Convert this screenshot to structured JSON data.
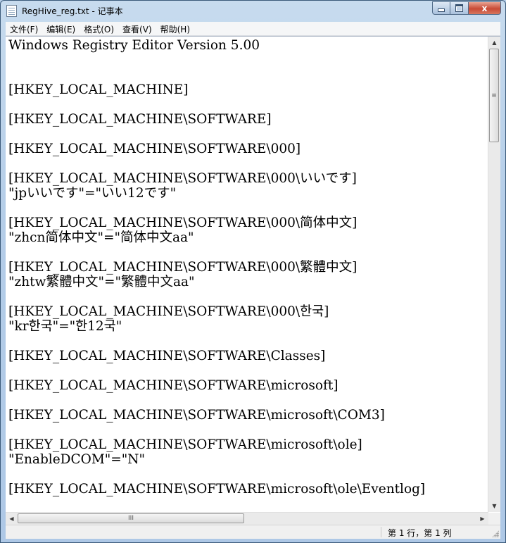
{
  "window": {
    "title": "RegHive_reg.txt - 记事本",
    "minimize_glyph": "",
    "close_glyph": "x"
  },
  "menubar": {
    "items": [
      "文件(F)",
      "编辑(E)",
      "格式(O)",
      "查看(V)",
      "帮助(H)"
    ]
  },
  "editor": {
    "lines": [
      "Windows Registry Editor Version 5.00",
      "",
      "",
      "[HKEY_LOCAL_MACHINE]",
      "",
      "[HKEY_LOCAL_MACHINE\\SOFTWARE]",
      "",
      "[HKEY_LOCAL_MACHINE\\SOFTWARE\\000]",
      "",
      "[HKEY_LOCAL_MACHINE\\SOFTWARE\\000\\いいです]",
      "\"jpいいです\"=\"いい12です\"",
      "",
      "[HKEY_LOCAL_MACHINE\\SOFTWARE\\000\\简体中文]",
      "\"zhcn简体中文\"=\"简体中文aa\"",
      "",
      "[HKEY_LOCAL_MACHINE\\SOFTWARE\\000\\繁體中文]",
      "\"zhtw繁體中文\"=\"繁體中文aa\"",
      "",
      "[HKEY_LOCAL_MACHINE\\SOFTWARE\\000\\한국]",
      "\"kr한국\"=\"한12국\"",
      "",
      "[HKEY_LOCAL_MACHINE\\SOFTWARE\\Classes]",
      "",
      "[HKEY_LOCAL_MACHINE\\SOFTWARE\\microsoft]",
      "",
      "[HKEY_LOCAL_MACHINE\\SOFTWARE\\microsoft\\COM3]",
      "",
      "[HKEY_LOCAL_MACHINE\\SOFTWARE\\microsoft\\ole]",
      "\"EnableDCOM\"=\"N\"",
      "",
      "[HKEY_LOCAL_MACHINE\\SOFTWARE\\microsoft\\ole\\Eventlog]"
    ]
  },
  "scrollbars": {
    "up_arrow": "▲",
    "down_arrow": "▼",
    "left_arrow": "◀",
    "right_arrow": "▶",
    "v_grip": "≡",
    "h_grip": "III"
  },
  "statusbar": {
    "position": "第 1 行，第 1 列"
  }
}
